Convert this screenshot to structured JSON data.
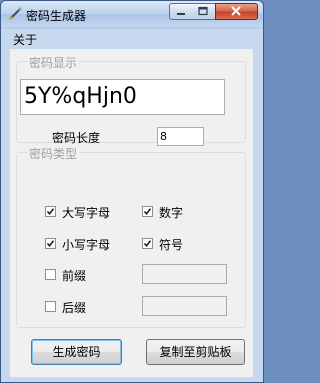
{
  "window": {
    "title": "密码生成器"
  },
  "menu": {
    "about": "关于"
  },
  "display_group": {
    "label": "密码显示",
    "password": "5Y%qHjn0",
    "length_label": "密码长度",
    "length_value": "8"
  },
  "type_group": {
    "label": "密码类型",
    "uppercase": {
      "label": "大写字母",
      "checked": true
    },
    "digits": {
      "label": "数字",
      "checked": true
    },
    "lowercase": {
      "label": "小写字母",
      "checked": true
    },
    "symbols": {
      "label": "符号",
      "checked": true
    },
    "prefix": {
      "label": "前缀",
      "checked": false,
      "value": ""
    },
    "suffix": {
      "label": "后缀",
      "checked": false,
      "value": ""
    }
  },
  "buttons": {
    "generate": "生成密码",
    "copy": "复制至剪贴板"
  }
}
